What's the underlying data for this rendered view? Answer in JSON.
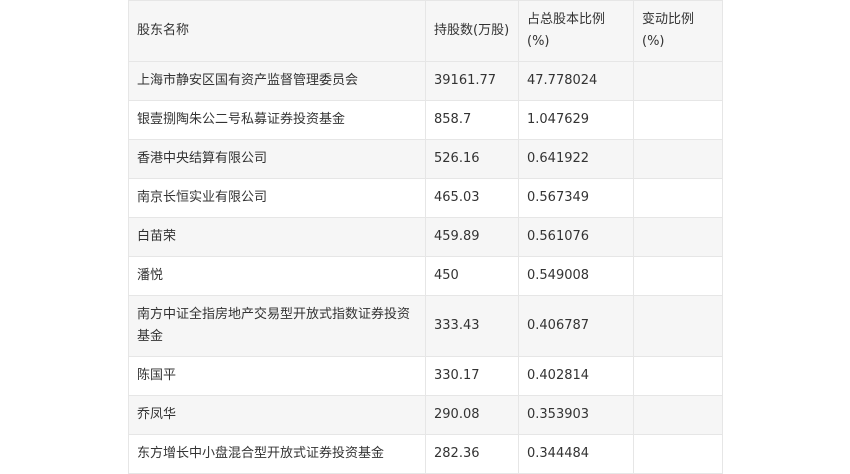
{
  "table": {
    "headers": [
      "股东名称",
      "持股数(万股)",
      "占总股本比例(%)",
      "变动比例(%)"
    ],
    "rows": [
      [
        "上海市静安区国有资产监督管理委员会",
        "39161.77",
        "47.778024",
        ""
      ],
      [
        "银壹捌陶朱公二号私募证券投资基金",
        "858.7",
        "1.047629",
        ""
      ],
      [
        "香港中央结算有限公司",
        "526.16",
        "0.641922",
        ""
      ],
      [
        "南京长恒实业有限公司",
        "465.03",
        "0.567349",
        ""
      ],
      [
        "白苗荣",
        "459.89",
        "0.561076",
        ""
      ],
      [
        "潘悦",
        "450",
        "0.549008",
        ""
      ],
      [
        "南方中证全指房地产交易型开放式指数证券投资基金",
        "333.43",
        "0.406787",
        ""
      ],
      [
        "陈国平",
        "330.17",
        "0.402814",
        ""
      ],
      [
        "乔凤华",
        "290.08",
        "0.353903",
        ""
      ],
      [
        "东方增长中小盘混合型开放式证券投资基金",
        "282.36",
        "0.344484",
        ""
      ]
    ]
  }
}
